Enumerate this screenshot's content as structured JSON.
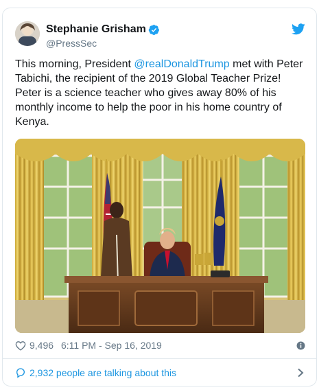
{
  "author": {
    "display_name": "Stephanie Grisham",
    "handle": "@PressSec",
    "verified": true,
    "avatar_icon": "avatar-photo"
  },
  "brand": {
    "icon": "twitter-bird-icon",
    "color": "#1da1f2"
  },
  "tweet": {
    "text_before": "This morning, President ",
    "mention": "@realDonaldTrump",
    "text_after": " met with Peter Tabichi, the recipient of the 2019 Global Teacher Prize! Peter is a science teacher who gives away 80% of his monthly income to help the poor in his home country of Kenya.",
    "mention_color": "#1b95e0"
  },
  "media": {
    "type": "photo"
  },
  "meta": {
    "like_icon": "heart-icon",
    "like_count": "9,496",
    "timestamp": "6:11 PM - Sep 16, 2019",
    "info_icon": "info-icon"
  },
  "footer": {
    "icon": "reply-bubble-icon",
    "text": "2,932 people are talking about this",
    "chevron_icon": "chevron-right-icon"
  }
}
